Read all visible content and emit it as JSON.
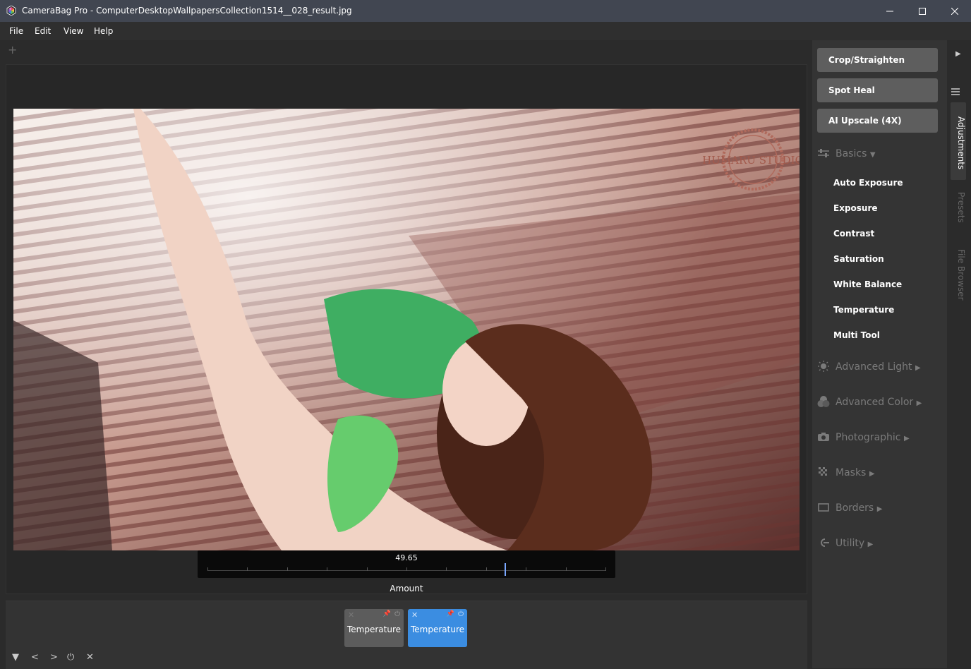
{
  "window": {
    "title": "CameraBag Pro - ComputerDesktopWallpapersCollection1514__028_result.jpg"
  },
  "menu": [
    "File",
    "Edit",
    "View",
    "Help"
  ],
  "photo": {
    "watermark": "HUMARU STUDIO"
  },
  "slider": {
    "value": "49.65",
    "label": "Amount"
  },
  "history": {
    "cards": [
      {
        "label": "Temperature",
        "state": "inactive"
      },
      {
        "label": "Temperature",
        "state": "active"
      }
    ],
    "controls": [
      "▼",
      "<",
      ">",
      "⏻",
      "✕"
    ]
  },
  "tools": {
    "crop": "Crop/Straighten",
    "spot_heal": "Spot Heal",
    "upscale": "AI Upscale (4X)"
  },
  "sections": {
    "basics": {
      "label": "Basics",
      "items": [
        "Auto Exposure",
        "Exposure",
        "Contrast",
        "Saturation",
        "White Balance",
        "Temperature",
        "Multi Tool"
      ]
    },
    "advanced_light": "Advanced Light",
    "advanced_color": "Advanced Color",
    "photographic": "Photographic",
    "masks": "Masks",
    "borders": "Borders",
    "utility": "Utility"
  },
  "vertical_tabs": [
    "Adjustments",
    "Presets",
    "File Browser"
  ],
  "colors": {
    "accent": "#3b8de1",
    "titlebar": "#414651",
    "panel": "#343434",
    "tool_button": "#5e5e5e"
  }
}
